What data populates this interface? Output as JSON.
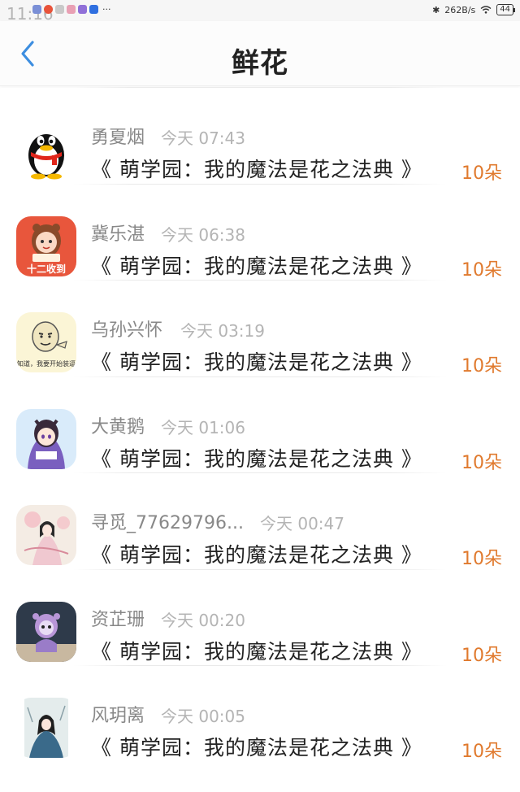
{
  "status_bar": {
    "time": "11:16",
    "more": "···",
    "network_speed": "262B/s",
    "battery": "44",
    "notification_icons": [
      {
        "name": "app-icon-1",
        "color": "#7a8fd6"
      },
      {
        "name": "weibo-icon",
        "color": "#e8533a"
      },
      {
        "name": "app-icon-3",
        "color": "#c9c9c9"
      },
      {
        "name": "app-icon-4",
        "color": "#e9a0b4"
      },
      {
        "name": "app-icon-5",
        "color": "#9070d8"
      },
      {
        "name": "app-icon-6",
        "color": "#2f6fe0"
      }
    ]
  },
  "header": {
    "title": "鲜花",
    "back_icon": "chevron-left-icon",
    "accent_color": "#3d8ee0"
  },
  "items": [
    {
      "username": "勇夏烟",
      "time": "今天 07:43",
      "book": "《 萌学园：我的魔法是花之法典 》",
      "count": "10朵",
      "avatar": "qq-penguin"
    },
    {
      "username": "冀乐湛",
      "time": "今天 06:38",
      "book": "《 萌学园：我的魔法是花之法典 》",
      "count": "10朵",
      "avatar": "cartoon-girl-checkin",
      "avatar_text": "十二收到"
    },
    {
      "username": "乌孙兴怀",
      "time": "今天 03:19",
      "book": "《 萌学园：我的魔法是花之法典 》",
      "count": "10朵",
      "avatar": "meme-face",
      "avatar_text": "知道，我要开始装逼"
    },
    {
      "username": "大黄鹅",
      "time": "今天 01:06",
      "book": "《 萌学园：我的魔法是花之法典 》",
      "count": "10朵",
      "avatar": "anime-girl"
    },
    {
      "username": "寻觅_77629796...",
      "time": "今天 00:47",
      "book": "《 萌学园：我的魔法是花之法典 》",
      "count": "10朵",
      "avatar": "ink-painting-lady"
    },
    {
      "username": "资芷珊",
      "time": "今天 00:20",
      "book": "《 萌学园：我的魔法是花之法典 》",
      "count": "10朵",
      "avatar": "doll-figure"
    },
    {
      "username": "风玥离",
      "time": "今天 00:05",
      "book": "《 萌学园：我的魔法是花之法典 》",
      "count": "10朵",
      "avatar": "costume-lady"
    }
  ]
}
